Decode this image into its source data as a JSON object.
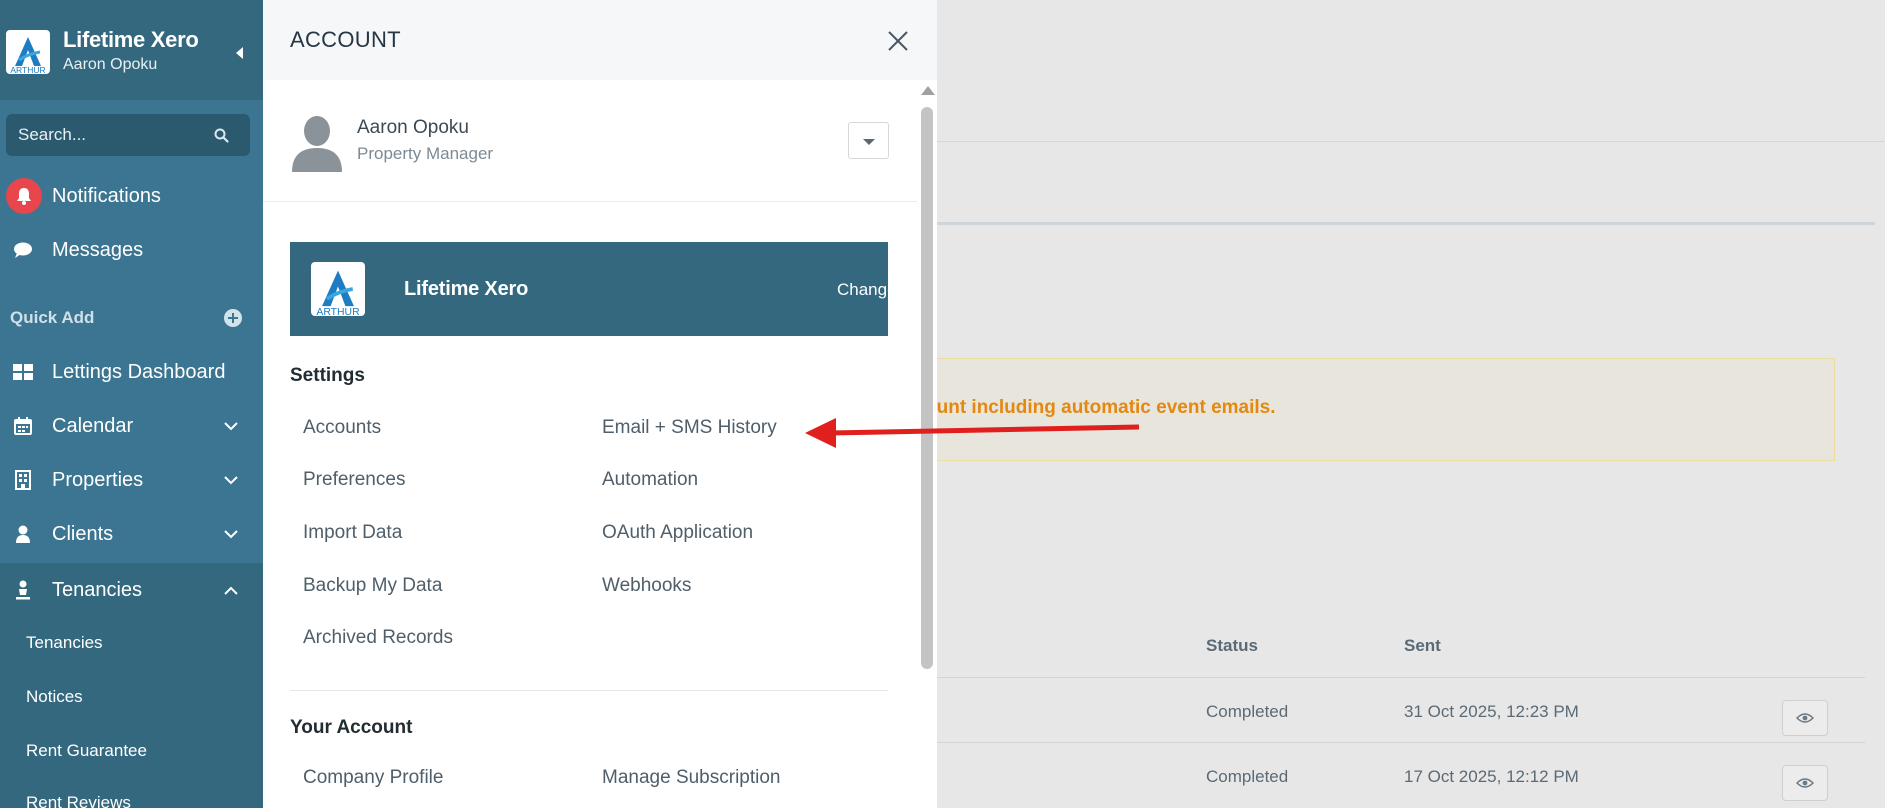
{
  "sidebar": {
    "title": "Lifetime Xero",
    "user": "Aaron Opoku",
    "search_placeholder": "Search...",
    "notifications_label": "Notifications",
    "messages_label": "Messages",
    "quick_add_label": "Quick Add",
    "nav": [
      {
        "label": "Lettings Dashboard",
        "icon": "dashboard-icon"
      },
      {
        "label": "Calendar",
        "icon": "calendar-icon"
      },
      {
        "label": "Properties",
        "icon": "building-icon"
      },
      {
        "label": "Clients",
        "icon": "person-icon"
      },
      {
        "label": "Tenancies",
        "icon": "tenant-icon"
      }
    ],
    "sub_items": [
      "Tenancies",
      "Notices",
      "Rent Guarantee",
      "Rent Reviews"
    ]
  },
  "panel": {
    "title": "ACCOUNT",
    "user_name": "Aaron Opoku",
    "user_role": "Property Manager",
    "company_name": "Lifetime Xero",
    "change_label": "Change",
    "settings_title": "Settings",
    "settings_left": [
      "Accounts",
      "Preferences",
      "Import Data",
      "Backup My Data",
      "Archived Records"
    ],
    "settings_right": [
      "Email + SMS History",
      "Automation",
      "OAuth Application",
      "Webhooks"
    ],
    "your_account_title": "Your Account",
    "account_left": [
      "Company Profile"
    ],
    "account_right": [
      "Manage Subscription"
    ]
  },
  "background": {
    "alert_text": "ount including automatic event emails.",
    "columns": {
      "status": "Status",
      "sent": "Sent"
    },
    "rows": [
      {
        "status": "Completed",
        "sent": "31 Oct 2025, 12:23 PM"
      },
      {
        "status": "Completed",
        "sent": "17 Oct 2025, 12:12 PM"
      }
    ]
  },
  "colors": {
    "sidebar": "#3b7591",
    "sidebar_dark": "#33687f",
    "alert_text": "#e4880f",
    "arrow": "#e0201e"
  },
  "logo_text": "ARTHUR"
}
